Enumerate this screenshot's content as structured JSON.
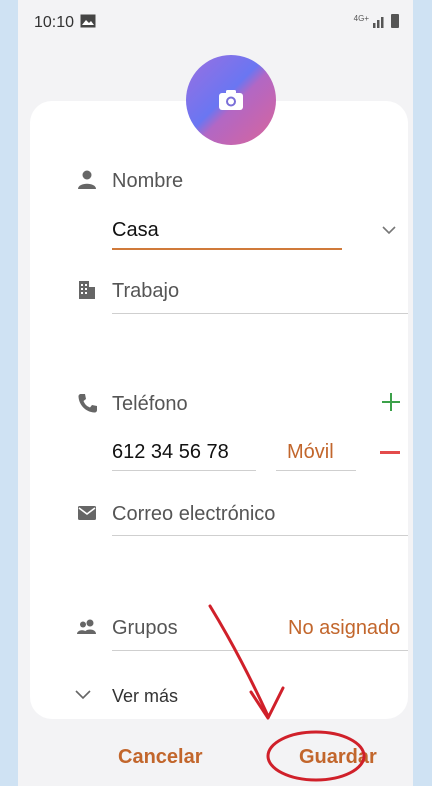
{
  "status_bar": {
    "time": "10:10",
    "network": "4G+"
  },
  "form": {
    "name_label": "Nombre",
    "name_value": "Casa",
    "work_label": "Trabajo",
    "phone_label": "Teléfono",
    "phone_value": "612 34 56 78",
    "phone_type": "Móvil",
    "email_label": "Correo electrónico",
    "groups_label": "Grupos",
    "groups_value": "No asignado",
    "see_more": "Ver más"
  },
  "actions": {
    "cancel": "Cancelar",
    "save": "Guardar"
  },
  "colors": {
    "accent": "#c2662c",
    "remove": "#e34b4b",
    "add": "#3ca14a",
    "annotation": "#d0202a"
  }
}
